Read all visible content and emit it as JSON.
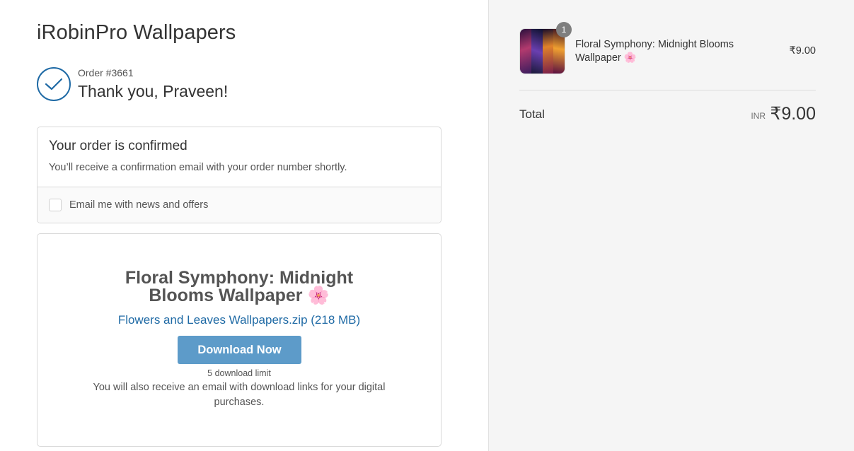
{
  "shop": {
    "title": "iRobinPro Wallpapers"
  },
  "order": {
    "number_label": "Order #3661",
    "thank_you": "Thank you, Praveen!"
  },
  "confirmation": {
    "heading": "Your order is confirmed",
    "text": "You’ll receive a confirmation email with your order number shortly.",
    "newsletter_label": "Email me with news and offers",
    "newsletter_checked": false
  },
  "download": {
    "product_title": "Floral Symphony: Midnight Blooms Wallpaper 🌸",
    "file_link": "Flowers and Leaves Wallpapers.zip (218 MB)",
    "button_label": "Download Now",
    "limit_text": "5 download limit",
    "note": "You will also receive an email with download links for your digital purchases."
  },
  "summary": {
    "items": [
      {
        "quantity": "1",
        "name": "Floral Symphony: Midnight Blooms Wallpaper 🌸",
        "price": "₹9.00"
      }
    ],
    "total_label": "Total",
    "currency": "INR",
    "total_amount": "₹9.00"
  },
  "colors": {
    "accent": "#1f6aa5",
    "button": "#5d9bc9",
    "sidebar_bg": "#f5f5f5"
  }
}
